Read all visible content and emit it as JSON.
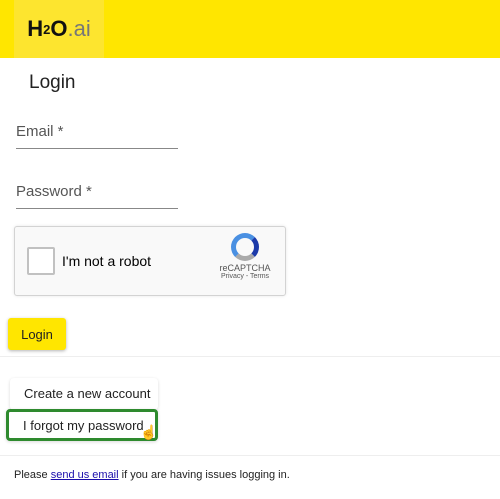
{
  "logo": {
    "h": "H",
    "two": "2",
    "o": "O",
    "ai": ".ai"
  },
  "page_title": "Login",
  "email": {
    "label": "Email *"
  },
  "password": {
    "label": "Password *"
  },
  "captcha": {
    "label": "I'm not a robot",
    "brand": "reCAPTCHA",
    "privacy": "Privacy",
    "sep": " - ",
    "terms": "Terms"
  },
  "login_button": "Login",
  "create_account": "Create a new account",
  "forgot_password": "I forgot my password",
  "footer": {
    "pre": "Please ",
    "link": "send us email",
    "post": " if you are having issues logging in."
  },
  "colors": {
    "brand": "#ffe600",
    "highlight": "#2e8a2e"
  }
}
